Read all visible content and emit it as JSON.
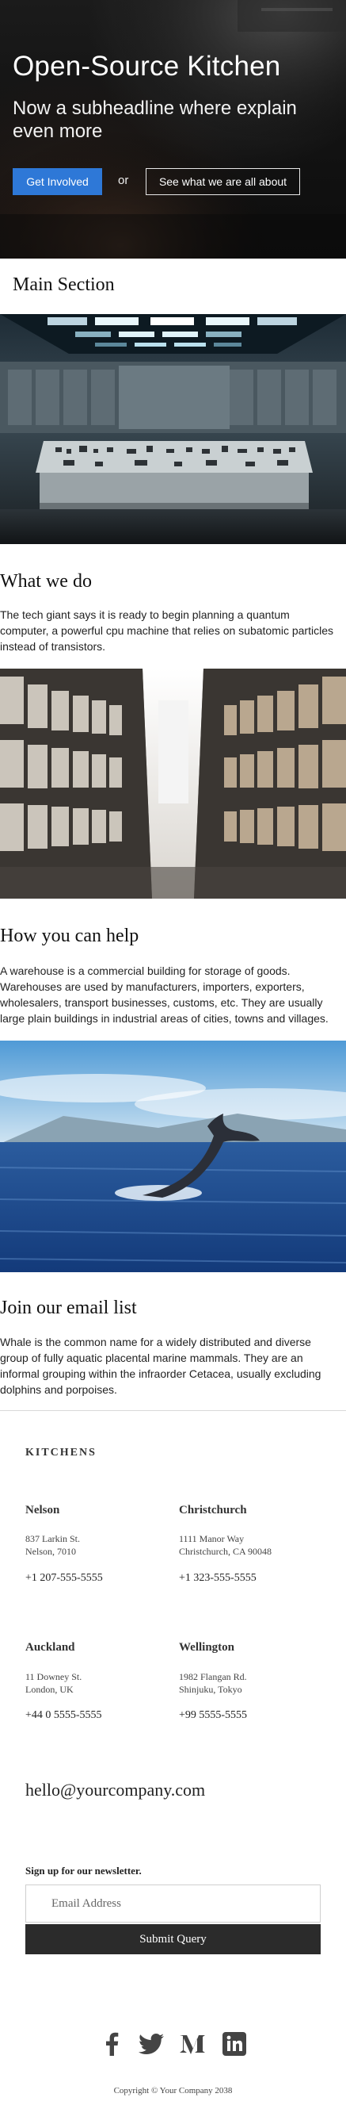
{
  "hero": {
    "title": "Open-Source Kitchen",
    "subheadline": "Now a subheadline where explain even more",
    "primary_button": "Get Involved",
    "or_text": "or",
    "secondary_button": "See what we are all about"
  },
  "main_section": {
    "title": "Main Section"
  },
  "what_we_do": {
    "title": "What we do",
    "text": "The tech giant says it is ready to begin planning a quantum computer, a powerful cpu machine that relies on subatomic particles instead of transistors."
  },
  "how_you_can_help": {
    "title": "How you can help",
    "text": "A warehouse is a commercial building for storage of goods. Warehouses are used by manufacturers, importers, exporters, wholesalers, transport businesses, customs, etc. They are usually large plain buildings in industrial areas of cities, towns and villages."
  },
  "email_list": {
    "title": "Join our email list",
    "text": "Whale is the common name for a widely distributed and diverse group of fully aquatic placental marine mammals. They are an informal grouping within the infraorder Cetacea, usually excluding dolphins and porpoises."
  },
  "footer": {
    "brand": "KITCHENS",
    "locations": [
      {
        "city": "Nelson",
        "address_line1": "837 Larkin St.",
        "address_line2": "Nelson, 7010",
        "phone": "+1 207-555-5555"
      },
      {
        "city": "Christchurch",
        "address_line1": "1111 Manor Way",
        "address_line2": "Christchurch, CA 90048",
        "phone": "+1 323-555-5555"
      },
      {
        "city": "Auckland",
        "address_line1": "11 Downey St.",
        "address_line2": "London, UK",
        "phone": "+44 0 5555-5555"
      },
      {
        "city": "Wellington",
        "address_line1": "1982 Flangan Rd.",
        "address_line2": "Shinjuku, Tokyo",
        "phone": "+99 5555-5555"
      }
    ],
    "email": "hello@yourcompany.com",
    "newsletter_label": "Sign up for our newsletter.",
    "email_placeholder": "Email Address",
    "submit_label": "Submit Query",
    "social_icons": [
      "facebook-icon",
      "twitter-icon",
      "medium-icon",
      "linkedin-icon"
    ],
    "copyright": "Copyright © Your Company 2038"
  },
  "colors": {
    "primary_button": "#2e78d7",
    "submit_button": "#2b2b2b",
    "social_icon": "#444444"
  }
}
